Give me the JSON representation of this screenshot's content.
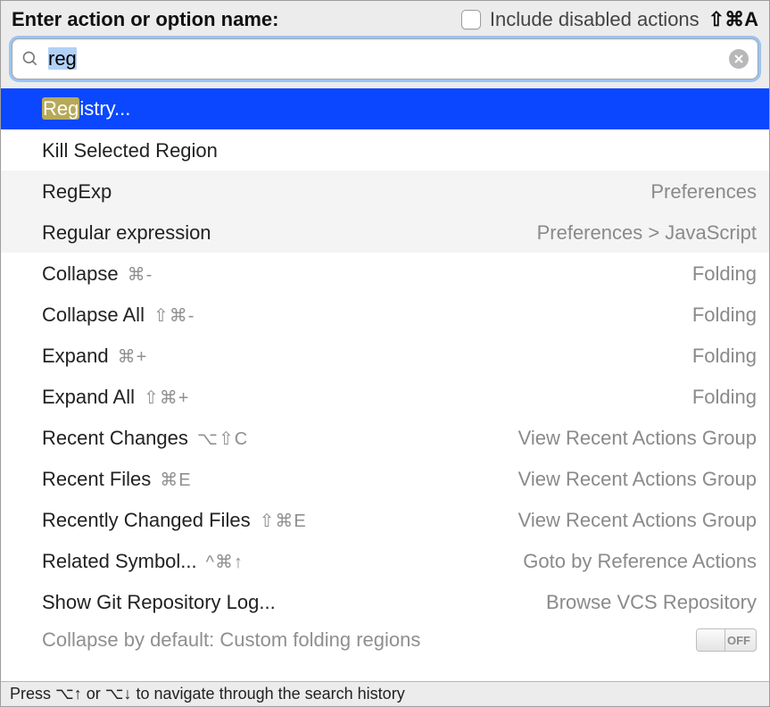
{
  "header": {
    "prompt": "Enter action or option name:",
    "include_label": "Include disabled actions",
    "include_shortcut": "⇧⌘A"
  },
  "search": {
    "value": "reg",
    "selection": "reg",
    "placeholder": ""
  },
  "footer": {
    "hint": "Press ⌥↑ or ⌥↓ to navigate through the search history"
  },
  "results": [
    {
      "label_pre": "",
      "label_match": "Reg",
      "label_post": "istry...",
      "shortcut": "",
      "group": "",
      "selected": true,
      "muted": false
    },
    {
      "label_pre": "Kill Selected Region",
      "label_match": "",
      "label_post": "",
      "shortcut": "",
      "group": "",
      "selected": false,
      "muted": false
    },
    {
      "label_pre": "RegExp",
      "label_match": "",
      "label_post": "",
      "shortcut": "",
      "group": "Preferences",
      "selected": false,
      "muted": true
    },
    {
      "label_pre": "Regular expression",
      "label_match": "",
      "label_post": "",
      "shortcut": "",
      "group": "Preferences > JavaScript",
      "selected": false,
      "muted": true
    },
    {
      "label_pre": "Collapse",
      "label_match": "",
      "label_post": "",
      "shortcut": "⌘-",
      "group": "Folding",
      "selected": false,
      "muted": false
    },
    {
      "label_pre": "Collapse All",
      "label_match": "",
      "label_post": "",
      "shortcut": "⇧⌘-",
      "group": "Folding",
      "selected": false,
      "muted": false
    },
    {
      "label_pre": "Expand",
      "label_match": "",
      "label_post": "",
      "shortcut": "⌘+",
      "group": "Folding",
      "selected": false,
      "muted": false
    },
    {
      "label_pre": "Expand All",
      "label_match": "",
      "label_post": "",
      "shortcut": "⇧⌘+",
      "group": "Folding",
      "selected": false,
      "muted": false
    },
    {
      "label_pre": "Recent Changes",
      "label_match": "",
      "label_post": "",
      "shortcut": "⌥⇧C",
      "group": "View Recent Actions Group",
      "selected": false,
      "muted": false
    },
    {
      "label_pre": "Recent Files",
      "label_match": "",
      "label_post": "",
      "shortcut": "⌘E",
      "group": "View Recent Actions Group",
      "selected": false,
      "muted": false
    },
    {
      "label_pre": "Recently Changed Files",
      "label_match": "",
      "label_post": "",
      "shortcut": "⇧⌘E",
      "group": "View Recent Actions Group",
      "selected": false,
      "muted": false
    },
    {
      "label_pre": "Related Symbol...",
      "label_match": "",
      "label_post": "",
      "shortcut": "^⌘↑",
      "group": "Goto by Reference Actions",
      "selected": false,
      "muted": false
    },
    {
      "label_pre": "Show Git Repository Log...",
      "label_match": "",
      "label_post": "",
      "shortcut": "",
      "group": "Browse VCS Repository",
      "selected": false,
      "muted": false
    }
  ],
  "partial": {
    "label": "Collapse by default: Custom folding regions",
    "toggle_text": "OFF"
  }
}
